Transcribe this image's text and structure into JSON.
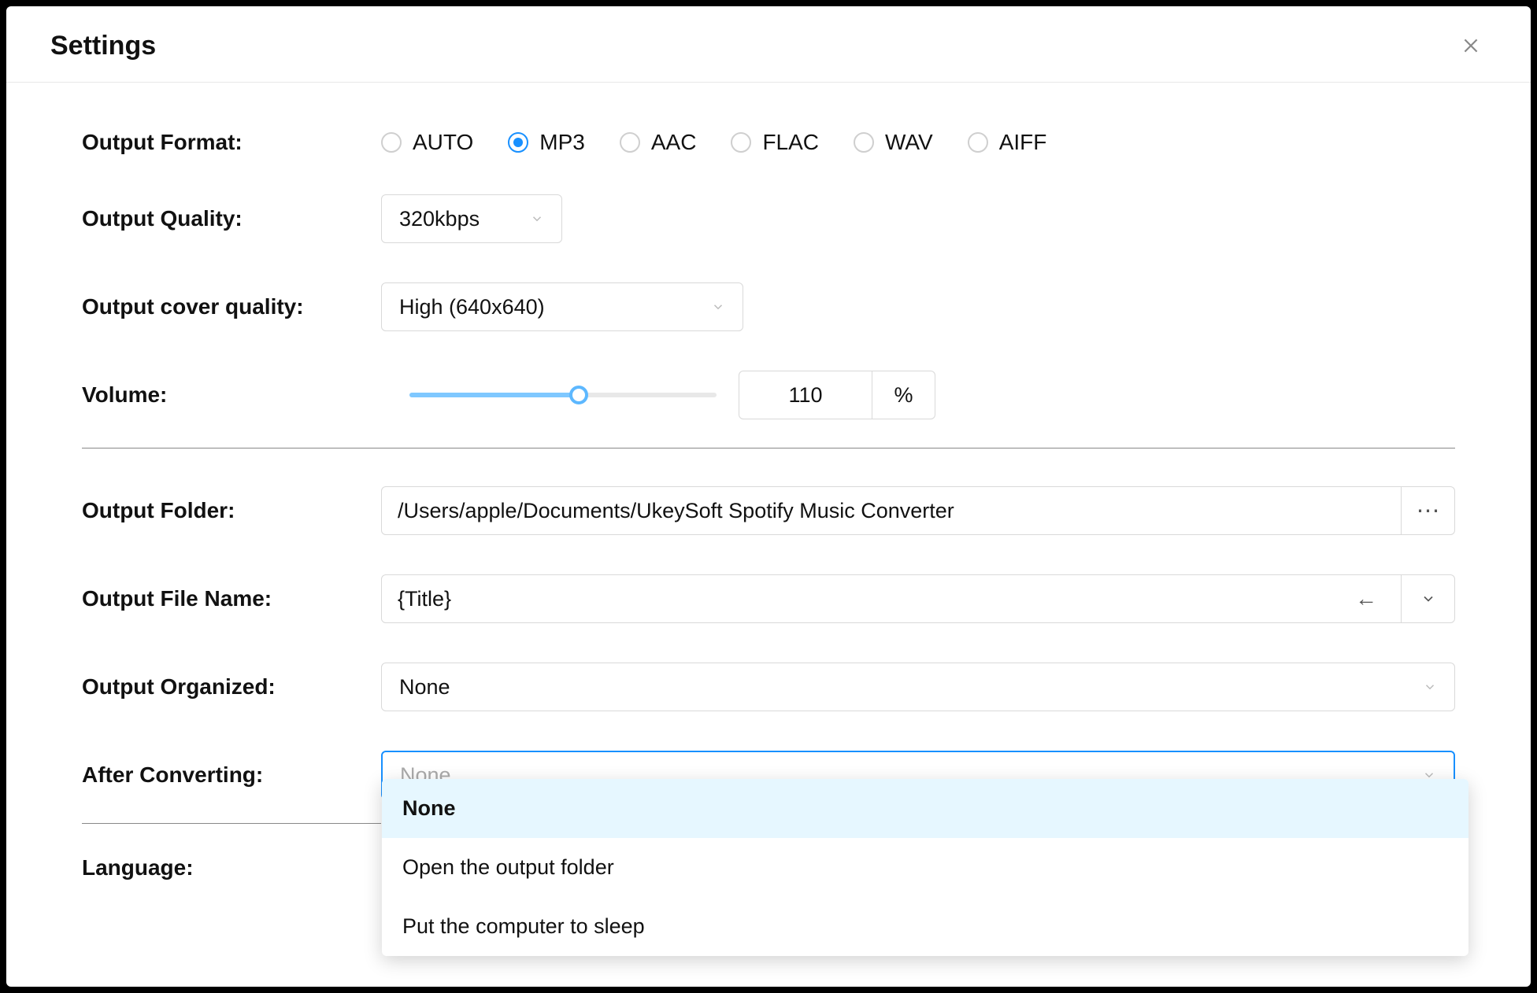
{
  "window": {
    "title": "Settings"
  },
  "fields": {
    "output_format": {
      "label": "Output Format:",
      "options": [
        "AUTO",
        "MP3",
        "AAC",
        "FLAC",
        "WAV",
        "AIFF"
      ],
      "selected": "MP3"
    },
    "output_quality": {
      "label": "Output Quality:",
      "value": "320kbps"
    },
    "output_cover_quality": {
      "label": "Output cover quality:",
      "value": "High (640x640)"
    },
    "volume": {
      "label": "Volume:",
      "value": "110",
      "unit": "%"
    },
    "output_folder": {
      "label": "Output Folder:",
      "value": "/Users/apple/Documents/UkeySoft Spotify Music Converter",
      "browse": "⋯"
    },
    "output_file_name": {
      "label": "Output File Name:",
      "value": "{Title}"
    },
    "output_organized": {
      "label": "Output Organized:",
      "value": "None"
    },
    "after_converting": {
      "label": "After Converting:",
      "value": "None",
      "options": [
        "None",
        "Open the output folder",
        "Put the computer to sleep"
      ]
    },
    "language": {
      "label": "Language:"
    }
  }
}
